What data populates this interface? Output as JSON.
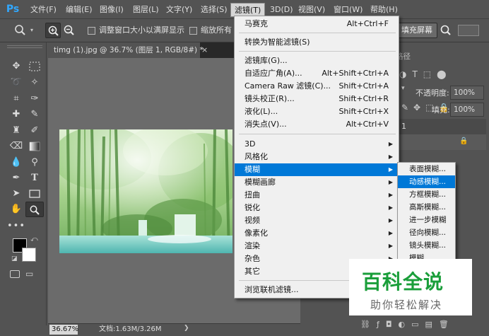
{
  "app": {
    "logo": "Ps"
  },
  "menubar": {
    "items": [
      "文件(F)",
      "编辑(E)",
      "图像(I)",
      "图层(L)",
      "文字(Y)",
      "选择(S)",
      "滤镜(T)",
      "3D(D)",
      "视图(V)",
      "窗口(W)",
      "帮助(H)"
    ],
    "active": "滤镜(T)"
  },
  "options": {
    "resize_windows_label": "调整窗口大小以满屏显示",
    "zoom_all_label": "缩放所有",
    "fill_screen_label": "填充屏幕"
  },
  "document": {
    "tab_title": "timg (1).jpg @ 36.7% (图层 1, RGB/8#) *",
    "zoom": "36.67%",
    "doc_info": "文档:1.63M/3.26M"
  },
  "panels": {
    "tab_label": "路径",
    "opacity_label": "不透明度:",
    "opacity_value": "100%",
    "fill_label": "填充:",
    "fill_value": "100%",
    "layer_name": "1"
  },
  "filter_menu": {
    "top_items": [
      {
        "label": "马赛克",
        "shortcut": "Alt+Ctrl+F"
      },
      {
        "label": "转换为智能滤镜(S)",
        "shortcut": ""
      }
    ],
    "mid_items": [
      {
        "label": "滤镜库(G)...",
        "shortcut": ""
      },
      {
        "label": "自适应广角(A)...",
        "shortcut": "Alt+Shift+Ctrl+A"
      },
      {
        "label": "Camera Raw 滤镜(C)...",
        "shortcut": "Shift+Ctrl+A"
      },
      {
        "label": "镜头校正(R)...",
        "shortcut": "Shift+Ctrl+R"
      },
      {
        "label": "液化(L)...",
        "shortcut": "Shift+Ctrl+X"
      },
      {
        "label": "消失点(V)...",
        "shortcut": "Alt+Ctrl+V"
      }
    ],
    "sub_items": [
      "3D",
      "风格化",
      "模糊",
      "模糊画廊",
      "扭曲",
      "锐化",
      "视频",
      "像素化",
      "渲染",
      "杂色",
      "其它"
    ],
    "highlighted": "模糊",
    "bottom_item": "浏览联机滤镜..."
  },
  "blur_submenu": {
    "items": [
      "表面模糊...",
      "动感模糊...",
      "方框模糊...",
      "高斯模糊...",
      "进一步模糊",
      "径向模糊...",
      "镜头模糊...",
      "模糊"
    ],
    "highlighted": "动感模糊..."
  },
  "watermark": {
    "logo": "百科全说",
    "subtitle": "助你轻松解决"
  },
  "colors": {
    "ps_blue": "#31a8ff",
    "highlight": "#0078d7",
    "watermark_green": "#1a9e3a"
  }
}
